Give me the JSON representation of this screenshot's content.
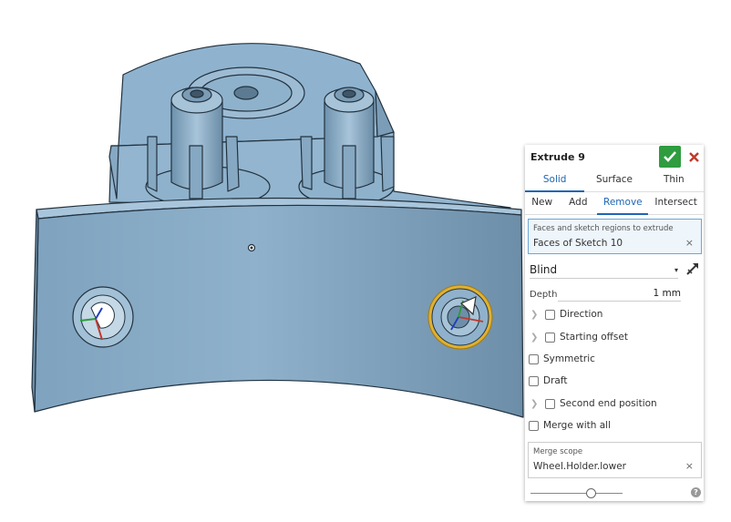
{
  "feature": {
    "title": "Extrude 9",
    "body_types": [
      "Solid",
      "Surface",
      "Thin"
    ],
    "active_body_type": "Solid",
    "operations": [
      "New",
      "Add",
      "Remove",
      "Intersect"
    ],
    "active_operation": "Remove"
  },
  "selection": {
    "caption": "Faces and sketch regions to extrude",
    "value": "Faces of Sketch 10",
    "clear": "×"
  },
  "end_type": {
    "value": "Blind",
    "caret": "▾"
  },
  "depth": {
    "label": "Depth",
    "value": "1 mm"
  },
  "options": {
    "direction": "Direction",
    "starting_offset": "Starting offset",
    "symmetric": "Symmetric",
    "draft": "Draft",
    "second_end": "Second end position",
    "merge_with_all": "Merge with all"
  },
  "merge_scope": {
    "caption": "Merge scope",
    "value": "Wheel.Holder.lower",
    "clear": "×"
  },
  "help_label": "?",
  "colors": {
    "accent": "#1f66b3",
    "confirm": "#2e9c3f",
    "cancel": "#c0392b",
    "model": "#8fb3cf",
    "highlight": "#e0b030"
  }
}
